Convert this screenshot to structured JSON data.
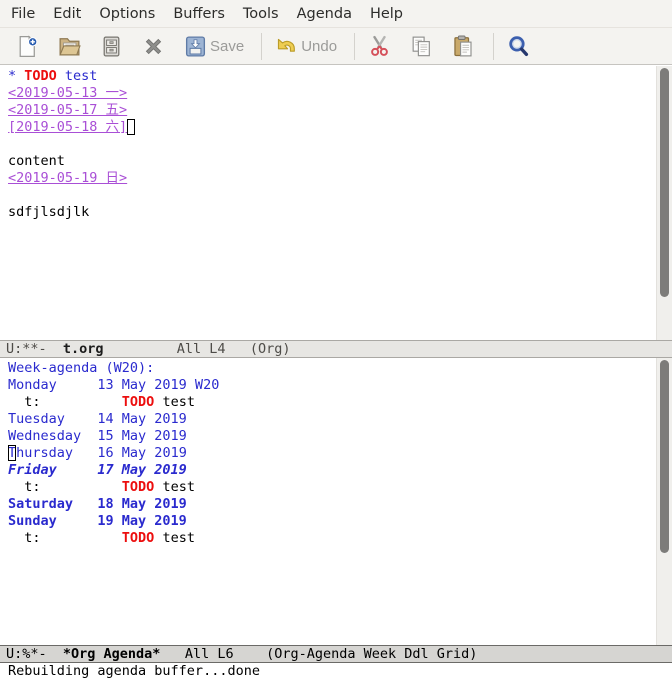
{
  "colors": {
    "agenda_blue": "#2a2ace",
    "todo_red": "#ec0e0e",
    "date_purple": "#a94fd6"
  },
  "menu": {
    "items": [
      "File",
      "Edit",
      "Options",
      "Buffers",
      "Tools",
      "Agenda",
      "Help"
    ]
  },
  "toolbar": {
    "icons": [
      "new-file",
      "open-file",
      "dired",
      "close-buffer",
      "save",
      "undo",
      "cut",
      "copy",
      "paste",
      "search"
    ],
    "save_label": "Save",
    "undo_label": "Undo"
  },
  "editor": {
    "lines": [
      [
        {
          "t": "* ",
          "s": "blue"
        },
        {
          "t": "TODO",
          "s": "red-bold"
        },
        {
          "t": " ",
          "s": "plain"
        },
        {
          "t": "test",
          "s": "blue"
        }
      ],
      [
        {
          "t": "<2019-05-13 一>",
          "s": "purple-u"
        }
      ],
      [
        {
          "t": "<2019-05-17 五>",
          "s": "purple-u"
        }
      ],
      [
        {
          "t": "[2019-05-18 六]",
          "s": "purple-u"
        },
        {
          "t": " ",
          "s": "hollow-cursor"
        }
      ],
      [],
      [
        {
          "t": "content",
          "s": "plain"
        }
      ],
      [
        {
          "t": "<2019-05-19 日>",
          "s": "purple-u"
        }
      ],
      [],
      [
        {
          "t": "sdfjlsdjlk",
          "s": "plain"
        }
      ]
    ]
  },
  "modeline_editor": {
    "prefix": "U:**-  ",
    "buffer": "t.org",
    "rest": "         All L4   (Org)"
  },
  "agenda": {
    "lines": [
      [
        {
          "t": "Week-agenda (W20):",
          "s": "blue"
        }
      ],
      [
        {
          "t": "Monday     13 May 2019 W20",
          "s": "blue"
        }
      ],
      [
        {
          "t": "  t:          ",
          "s": "plain"
        },
        {
          "t": "TODO",
          "s": "red-bold"
        },
        {
          "t": " test",
          "s": "plain"
        }
      ],
      [
        {
          "t": "Tuesday    14 May 2019",
          "s": "blue"
        }
      ],
      [
        {
          "t": "Wednesday  15 May 2019",
          "s": "blue"
        }
      ],
      [
        {
          "t": "T",
          "s": "blue hollow-cursor"
        },
        {
          "t": "hursday   16 May 2019",
          "s": "blue"
        }
      ],
      [
        {
          "t": "Friday     17 May 2019",
          "s": "blue-bi"
        }
      ],
      [
        {
          "t": "  t:          ",
          "s": "plain"
        },
        {
          "t": "TODO",
          "s": "red-bold"
        },
        {
          "t": " test",
          "s": "plain"
        }
      ],
      [
        {
          "t": "Saturday   18 May 2019",
          "s": "blue-bold"
        }
      ],
      [
        {
          "t": "Sunday     19 May 2019",
          "s": "blue-bold"
        }
      ],
      [
        {
          "t": "  t:          ",
          "s": "plain"
        },
        {
          "t": "TODO",
          "s": "red-bold"
        },
        {
          "t": " test",
          "s": "plain"
        }
      ]
    ]
  },
  "modeline_agenda": {
    "prefix": "U:%*-  ",
    "buffer": "*Org Agenda*",
    "rest": "   All L6    (Org-Agenda Week Ddl Grid)"
  },
  "echo": {
    "message": "Rebuilding agenda buffer...done"
  }
}
